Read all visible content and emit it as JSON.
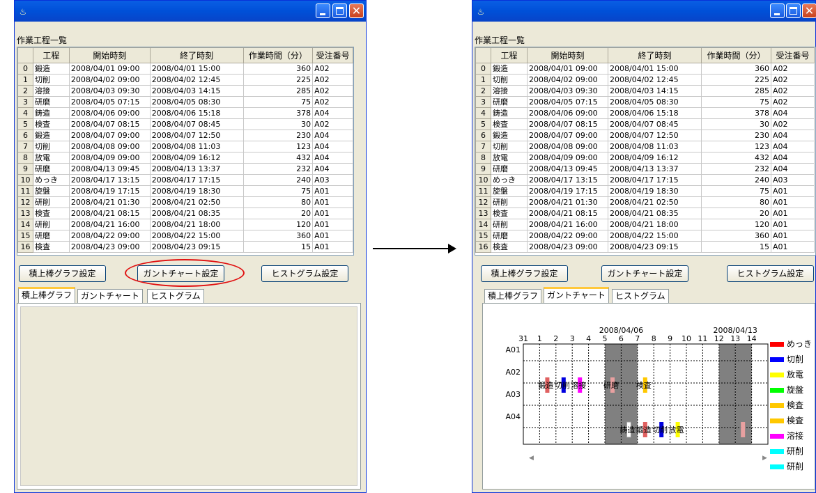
{
  "titlebar": {
    "icon": "java-cup-icon",
    "close_glyph": "✕"
  },
  "list_label": "作業工程一覧",
  "table": {
    "headers": [
      "",
      "工程",
      "開始時刻",
      "終了時刻",
      "作業時間（分）",
      "受注番号"
    ],
    "rows": [
      [
        "0",
        "鍛造",
        "2008/04/01 09:00",
        "2008/04/01 15:00",
        "360",
        "A02"
      ],
      [
        "1",
        "切削",
        "2008/04/02 09:00",
        "2008/04/02 12:45",
        "225",
        "A02"
      ],
      [
        "2",
        "溶接",
        "2008/04/03 09:30",
        "2008/04/03 14:15",
        "285",
        "A02"
      ],
      [
        "3",
        "研磨",
        "2008/04/05 07:15",
        "2008/04/05 08:30",
        "75",
        "A02"
      ],
      [
        "4",
        "鋳造",
        "2008/04/06 09:00",
        "2008/04/06 15:18",
        "378",
        "A04"
      ],
      [
        "5",
        "検査",
        "2008/04/07 08:15",
        "2008/04/07 08:45",
        "30",
        "A02"
      ],
      [
        "6",
        "鍛造",
        "2008/04/07 09:00",
        "2008/04/07 12:50",
        "230",
        "A04"
      ],
      [
        "7",
        "切削",
        "2008/04/08 09:00",
        "2008/04/08 11:03",
        "123",
        "A04"
      ],
      [
        "8",
        "放電",
        "2008/04/09 09:00",
        "2008/04/09 16:12",
        "432",
        "A04"
      ],
      [
        "9",
        "研磨",
        "2008/04/13 09:45",
        "2008/04/13 13:37",
        "232",
        "A04"
      ],
      [
        "10",
        "めっき",
        "2008/04/17 13:15",
        "2008/04/17 17:15",
        "240",
        "A03"
      ],
      [
        "11",
        "旋盤",
        "2008/04/19 17:15",
        "2008/04/19 18:30",
        "75",
        "A01"
      ],
      [
        "12",
        "研削",
        "2008/04/21 01:30",
        "2008/04/21 02:50",
        "80",
        "A01"
      ],
      [
        "13",
        "検査",
        "2008/04/21 08:15",
        "2008/04/21 08:35",
        "20",
        "A01"
      ],
      [
        "14",
        "研削",
        "2008/04/21 16:00",
        "2008/04/21 18:00",
        "120",
        "A01"
      ],
      [
        "15",
        "研磨",
        "2008/04/22 09:00",
        "2008/04/22 15:00",
        "360",
        "A01"
      ],
      [
        "16",
        "検査",
        "2008/04/23 09:00",
        "2008/04/23 09:15",
        "15",
        "A01"
      ]
    ]
  },
  "buttons": {
    "stack": "積上棒グラフ設定",
    "gantt": "ガントチャート設定",
    "hist": "ヒストグラム設定"
  },
  "tabs": [
    "積上棒グラフ",
    "ガントチャート",
    "ヒストグラム"
  ],
  "chart_data": {
    "type": "gantt",
    "date_labels": [
      "2008/04/06",
      "2008/04/13"
    ],
    "day_ticks": [
      "31",
      "1",
      "2",
      "3",
      "4",
      "5",
      "6",
      "7",
      "8",
      "9",
      "10",
      "11",
      "12",
      "13",
      "14"
    ],
    "rows": [
      "A01",
      "A02",
      "A03",
      "A04"
    ],
    "weekend_day_ticks": [
      "5",
      "6",
      "12",
      "13"
    ],
    "tasks": [
      {
        "row": "A02",
        "label": "鍛造",
        "day": "1",
        "color": "#e06060"
      },
      {
        "row": "A02",
        "label": "切削",
        "day": "2",
        "color": "#0000e0"
      },
      {
        "row": "A02",
        "label": "溶接",
        "day": "3",
        "color": "#ff00ff"
      },
      {
        "row": "A02",
        "label": "研磨",
        "day": "5",
        "color": "#e8a0a0"
      },
      {
        "row": "A02",
        "label": "検査",
        "day": "7",
        "color": "#ffc800"
      },
      {
        "row": "A04",
        "label": "鋳造",
        "day": "6",
        "color": "#ffffff"
      },
      {
        "row": "A04",
        "label": "鍛造",
        "day": "7",
        "color": "#e06060"
      },
      {
        "row": "A04",
        "label": "切削",
        "day": "8",
        "color": "#0000e0"
      },
      {
        "row": "A04",
        "label": "放電",
        "day": "9",
        "color": "#ffff00"
      },
      {
        "row": "A04",
        "label": "",
        "day": "13",
        "color": "#e8a0a0"
      }
    ],
    "legend": [
      {
        "name": "めっき",
        "color": "#ff0000"
      },
      {
        "name": "切削",
        "color": "#0000ff"
      },
      {
        "name": "放電",
        "color": "#ffff00"
      },
      {
        "name": "旋盤",
        "color": "#00ff00"
      },
      {
        "name": "検査",
        "color": "#ffc800"
      },
      {
        "name": "検査",
        "color": "#ffc800"
      },
      {
        "name": "溶接",
        "color": "#ff00ff"
      },
      {
        "name": "研削",
        "color": "#00ffff"
      },
      {
        "name": "研削",
        "color": "#00ffff"
      }
    ]
  }
}
